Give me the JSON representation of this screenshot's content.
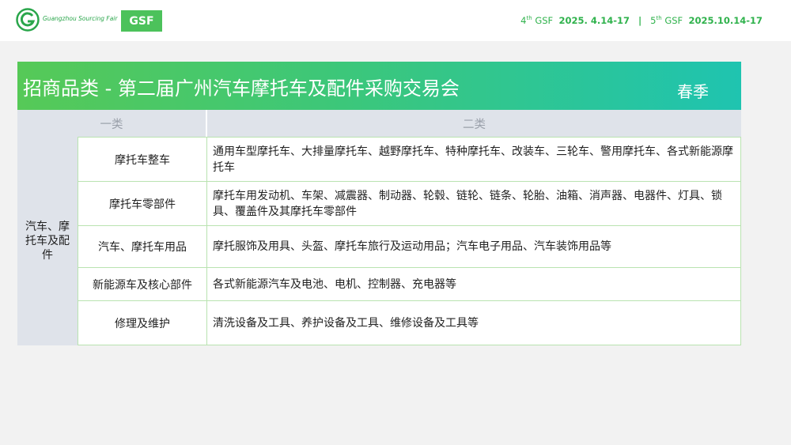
{
  "header": {
    "logo_text": "Guangzhou Sourcing Fair",
    "badge": "GSF",
    "edition1_num": "4",
    "edition1_sup": "th",
    "edition1_name": "GSF",
    "edition1_date": "2025. 4.14-17",
    "separator": "|",
    "edition2_num": "5",
    "edition2_sup": "th",
    "edition2_name": "GSF",
    "edition2_date": "2025.10.14-17"
  },
  "panel": {
    "title": "招商品类 - 第二届广州汽车摩托车及配件采购交易会",
    "season": "春季",
    "col1_header": "一类",
    "col2_header": "二类",
    "category1": "汽车、摩托车及配件",
    "rows": [
      {
        "sub": "摩托车整车",
        "items": "通用车型摩托车、大排量摩托车、越野摩托车、特种摩托车、改装车、三轮车、警用摩托车、各式新能源摩托车"
      },
      {
        "sub": "摩托车零部件",
        "items": "摩托车用发动机、车架、减震器、制动器、轮毂、链轮、链条、轮胎、油箱、消声器、电器件、灯具、锁具、覆盖件及其摩托车零部件"
      },
      {
        "sub": "汽车、摩托车用品",
        "items": "摩托服饰及用具、头盔、摩托车旅行及运动用品；汽车电子用品、汽车装饰用品等"
      },
      {
        "sub": "新能源车及核心部件",
        "items": "各式新能源汽车及电池、电机、控制器、充电器等"
      },
      {
        "sub": "修理及维护",
        "items": "清洗设备及工具、养护设备及工具、维修设备及工具等"
      }
    ]
  },
  "colors": {
    "brand_green": "#4cc25b",
    "title_gradient_start": "#56c957",
    "title_gradient_end": "#1fc4b0"
  }
}
